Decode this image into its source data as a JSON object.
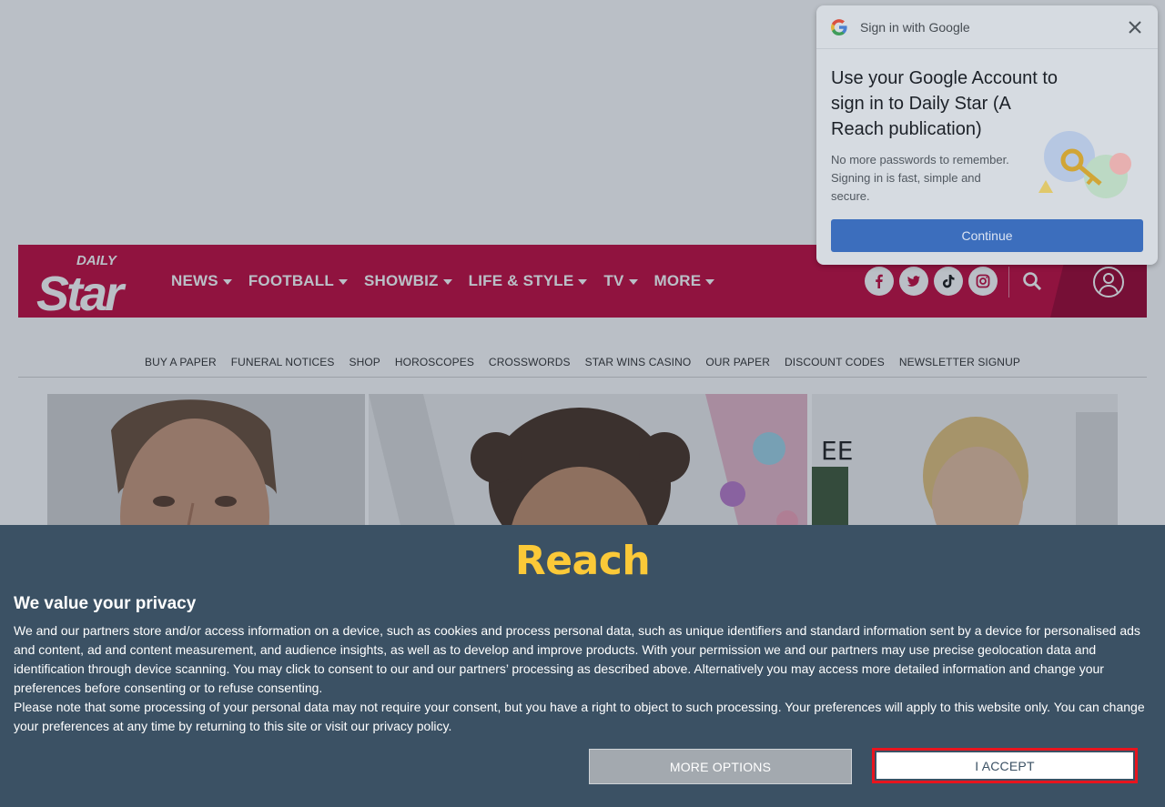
{
  "masthead": {
    "brand": "Star",
    "brand_top": "DAILY",
    "nav": [
      {
        "label": "NEWS",
        "icon": "caret-down-icon"
      },
      {
        "label": "FOOTBALL",
        "icon": "caret-down-icon"
      },
      {
        "label": "SHOWBIZ",
        "icon": "caret-down-icon"
      },
      {
        "label": "LIFE & STYLE",
        "icon": "caret-down-icon"
      },
      {
        "label": "TV",
        "icon": "caret-down-icon"
      },
      {
        "label": "MORE",
        "icon": "caret-down-icon"
      }
    ],
    "social_icons": [
      "facebook-icon",
      "twitter-icon",
      "tiktok-icon",
      "instagram-icon"
    ],
    "search_icon": "search-icon",
    "account_icon": "user-icon",
    "brand_color": "#c3093e"
  },
  "subnav": [
    "BUY A PAPER",
    "FUNERAL NOTICES",
    "SHOP",
    "HOROSCOPES",
    "CROSSWORDS",
    "STAR WINS CASINO",
    "OUR PAPER",
    "DISCOUNT CODES",
    "NEWSLETTER SIGNUP"
  ],
  "google_signin": {
    "header": "Sign in with Google",
    "title": "Use your Google Account to sign in to Daily Star (A Reach publication)",
    "description": "No more passwords to remember. Signing in is fast, simple and secure.",
    "button": "Continue",
    "close_icon": "close-icon",
    "logo_icon": "google-g-icon",
    "button_color": "#3c6ebd"
  },
  "consent": {
    "logo": "Reach",
    "title": "We value your privacy",
    "paragraph_1": "We and our partners store and/or access information on a device, such as cookies and process personal data, such as unique identifiers and standard information sent by a device for personalised ads and content, ad and content measurement, and audience insights, as well as to develop and improve products. With your permission we and our partners may use precise geolocation data and identification through device scanning. You may click to consent to our and our partners’ processing as described above. Alternatively you may access more detailed information and change your preferences before consenting or to refuse consenting.",
    "paragraph_2": "Please note that some processing of your personal data may not require your consent, but you have a right to object to such processing. Your preferences will apply to this website only. You can change your preferences at any time by returning to this site or visit our privacy policy.",
    "more_options": "MORE OPTIONS",
    "accept": "I ACCEPT",
    "background_color": "#3b5164",
    "logo_color": "#fbc938",
    "highlight_color": "#e8141e"
  }
}
